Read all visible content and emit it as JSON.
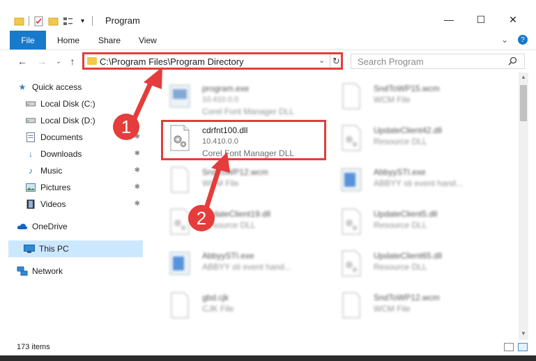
{
  "window": {
    "title": "Program",
    "minimize_glyph": "—",
    "maximize_glyph": "☐",
    "close_glyph": "✕"
  },
  "ribbon": {
    "file_label": "File",
    "tabs": [
      "Home",
      "Share",
      "View"
    ],
    "collapse_glyph": "⌄",
    "help_glyph": "?"
  },
  "navigation": {
    "back_glyph": "←",
    "forward_glyph": "→",
    "recent_glyph": "⌄",
    "up_glyph": "↑"
  },
  "address": {
    "path": "C:\\Program Files\\Program Directory",
    "dropdown_glyph": "⌄",
    "refresh_glyph": "↻"
  },
  "search": {
    "placeholder": "Search Program",
    "icon": "search-icon"
  },
  "sidebar": {
    "items": [
      {
        "label": "Quick access",
        "icon": "star-icon",
        "pinned": false
      },
      {
        "label": "Local Disk (C:)",
        "icon": "drive-icon",
        "pinned": false
      },
      {
        "label": "Local Disk (D:)",
        "icon": "drive-icon",
        "pinned": false
      },
      {
        "label": "Documents",
        "icon": "documents-icon",
        "pinned": true
      },
      {
        "label": "Downloads",
        "icon": "download-icon",
        "pinned": true
      },
      {
        "label": "Music",
        "icon": "music-icon",
        "pinned": true
      },
      {
        "label": "Pictures",
        "icon": "pictures-icon",
        "pinned": true
      },
      {
        "label": "Videos",
        "icon": "videos-icon",
        "pinned": true
      },
      {
        "label": "OneDrive",
        "icon": "cloud-icon",
        "pinned": false
      },
      {
        "label": "This PC",
        "icon": "computer-icon",
        "pinned": false,
        "selected": true
      },
      {
        "label": "Network",
        "icon": "network-icon",
        "pinned": false
      }
    ],
    "pin_glyph": "📌"
  },
  "files": [
    {
      "name": "program.exe",
      "version": "10.410.0.0",
      "type": "Corel Font Manager DLL",
      "icon": "exe-icon",
      "blurred": true
    },
    {
      "name": "SndToWP15.wcm",
      "version": "",
      "type": "WCM File",
      "icon": "file-icon",
      "blurred": true
    },
    {
      "name": "cdrfnt100.dll",
      "version": "10.410.0.0",
      "type": "Corel Font Manager DLL",
      "icon": "dll-icon",
      "blurred": false
    },
    {
      "name": "UpdateClient42.dll",
      "version": "",
      "type": "Resource DLL",
      "icon": "dll-icon",
      "blurred": true
    },
    {
      "name": "SndToWP12.wcm",
      "version": "",
      "type": "WCM File",
      "icon": "file-icon",
      "blurred": true
    },
    {
      "name": "AbbyySTI.exe",
      "version": "",
      "type": "ABBYY sti event hand...",
      "icon": "exe-icon",
      "blurred": true
    },
    {
      "name": "UpdateClient19.dll",
      "version": "",
      "type": "Resource DLL",
      "icon": "dll-icon",
      "blurred": true
    },
    {
      "name": "UpdateClient5.dll",
      "version": "",
      "type": "Resource DLL",
      "icon": "dll-icon",
      "blurred": true
    },
    {
      "name": "AbbyySTI.exe",
      "version": "",
      "type": "ABBYY sti event hand...",
      "icon": "exe-icon",
      "blurred": true
    },
    {
      "name": "UpdateClient65.dll",
      "version": "",
      "type": "Resource DLL",
      "icon": "dll-icon",
      "blurred": true
    },
    {
      "name": "gbd.cjk",
      "version": "",
      "type": "CJK File",
      "icon": "file-icon",
      "blurred": true
    },
    {
      "name": "SndToWP12.wcm",
      "version": "",
      "type": "WCM File",
      "icon": "file-icon",
      "blurred": true
    }
  ],
  "status": {
    "item_count": "173 items"
  },
  "annotations": {
    "step1": "1",
    "step2": "2",
    "color": "#e53c3c"
  },
  "colors": {
    "accent": "#1979ca",
    "selection": "#cce8ff",
    "highlight_border": "#e53c3c"
  }
}
